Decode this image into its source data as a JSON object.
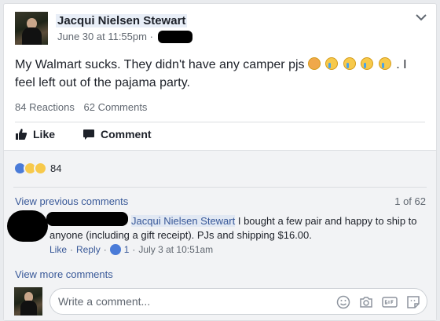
{
  "post": {
    "author": "Jacqui Nielsen Stewart",
    "timestamp": "June 30 at 11:55pm",
    "separator": "·",
    "text_before": "My Walmart sucks. They didn't have any camper pjs ",
    "text_after": ". I feel left out of the pajama party."
  },
  "stats": {
    "reactions": "84 Reactions",
    "comments": "62 Comments"
  },
  "actions": {
    "like": "Like",
    "comment": "Comment"
  },
  "reactions_summary": {
    "count": "84"
  },
  "comments": {
    "view_previous": "View previous comments",
    "pager": "1 of 62",
    "items": [
      {
        "mention": "Jacqui Nielsen Stewart",
        "text": " I bought a few pair and happy to ship to anyone (including a gift receipt). PJs and shipping $16.00.",
        "like_label": "Like",
        "reply_label": "Reply",
        "like_count": "1",
        "timestamp": "July 3 at 10:51am",
        "dot": "·"
      }
    ],
    "view_more": "View more comments"
  },
  "composer": {
    "placeholder": "Write a comment..."
  },
  "colors": {
    "link": "#385898",
    "like_blue": "#4a7bd8",
    "background": "#e9ebee"
  }
}
